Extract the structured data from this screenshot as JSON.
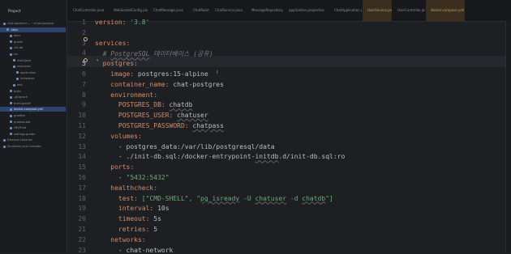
{
  "sidebar": {
    "title": "Project",
    "items": [
      {
        "label": "chat-backend — ~/chat-backend",
        "selected": false
      },
      {
        "label": ".idea",
        "selected": true
      },
      {
        "label": "docs",
        "selected": false
      },
      {
        "label": "gradle",
        "selected": false
      },
      {
        "label": "init-db",
        "selected": false
      },
      {
        "label": "src",
        "selected": false
      },
      {
        "label": "main/java",
        "selected": false
      },
      {
        "label": "resources",
        "selected": false
      },
      {
        "label": "application",
        "selected": false
      },
      {
        "label": "templates",
        "selected": false
      },
      {
        "label": "test",
        "selected": false
      },
      {
        "label": "build",
        "selected": false
      },
      {
        "label": ".gitignore",
        "selected": false
      },
      {
        "label": "build.gradle",
        "selected": false
      },
      {
        "label": "docker-compose.yml",
        "selected": true
      },
      {
        "label": "gradlew",
        "selected": false
      },
      {
        "label": "gradlew.bat",
        "selected": false
      },
      {
        "label": "HELP.md",
        "selected": false
      },
      {
        "label": "settings.gradle",
        "selected": false
      },
      {
        "label": "External Libraries",
        "selected": false
      },
      {
        "label": "Scratches and Consoles",
        "selected": false
      }
    ]
  },
  "tabs": [
    {
      "label": "ChatController.java",
      "active": false
    },
    {
      "label": "WebSocketConfig.java",
      "active": false
    },
    {
      "label": "ChatMessage.java",
      "active": false
    },
    {
      "label": "ChatRoom.java",
      "active": false
    },
    {
      "label": "ChatService.java",
      "active": false
    },
    {
      "label": "MessageRepository.java",
      "active": false
    },
    {
      "label": "application.properties",
      "active": false
    },
    {
      "label": "ChatApplication.java",
      "active": false
    },
    {
      "label": "UserService.java",
      "active": false
    },
    {
      "label": "UserController.java",
      "active": false
    },
    {
      "label": "docker-compose.yml",
      "active": true
    }
  ],
  "editor": {
    "current_line": 5,
    "lines": [
      {
        "n": "1",
        "tokens": [
          {
            "t": "version: ",
            "c": "k"
          },
          {
            "t": "'3.8'",
            "c": "s"
          }
        ]
      },
      {
        "n": "2",
        "tokens": []
      },
      {
        "n": "3",
        "tokens": [
          {
            "t": "services:",
            "c": "k"
          }
        ]
      },
      {
        "n": "4",
        "tokens": [
          {
            "t": "  # ",
            "c": "c"
          },
          {
            "t": "PostgreSQL",
            "c": "c u"
          },
          {
            "t": " 데이터베이스 (공유)",
            "c": "c"
          }
        ]
      },
      {
        "n": "5",
        "tokens": [
          {
            "t": "  postgres:",
            "c": "k"
          }
        ]
      },
      {
        "n": "6",
        "tokens": [
          {
            "t": "    image: ",
            "c": "k"
          },
          {
            "t": "postgres:15-alpine",
            "c": "p"
          }
        ]
      },
      {
        "n": "7",
        "tokens": [
          {
            "t": "    container_name: ",
            "c": "k"
          },
          {
            "t": "chat-postgres",
            "c": "p"
          }
        ]
      },
      {
        "n": "8",
        "tokens": [
          {
            "t": "    environment:",
            "c": "k"
          }
        ]
      },
      {
        "n": "9",
        "tokens": [
          {
            "t": "      POSTGRES_DB: ",
            "c": "k"
          },
          {
            "t": "chatdb",
            "c": "p u"
          }
        ]
      },
      {
        "n": "10",
        "tokens": [
          {
            "t": "      POSTGRES_USER: ",
            "c": "k"
          },
          {
            "t": "chatuser",
            "c": "p u"
          }
        ]
      },
      {
        "n": "11",
        "tokens": [
          {
            "t": "      POSTGRES_PASSWORD: ",
            "c": "k"
          },
          {
            "t": "chatpass",
            "c": "p u"
          }
        ]
      },
      {
        "n": "12",
        "tokens": [
          {
            "t": "    volumes:",
            "c": "k"
          }
        ]
      },
      {
        "n": "13",
        "tokens": [
          {
            "t": "      - postgres_data:/var/lib/postgresql/data",
            "c": "p"
          }
        ]
      },
      {
        "n": "14",
        "tokens": [
          {
            "t": "      - ./init-db.sql:/docker-entrypoint-",
            "c": "p"
          },
          {
            "t": "initdb",
            "c": "p u"
          },
          {
            "t": ".d/init-db.sql:ro",
            "c": "p"
          }
        ]
      },
      {
        "n": "15",
        "tokens": [
          {
            "t": "    ports:",
            "c": "k"
          }
        ]
      },
      {
        "n": "16",
        "tokens": [
          {
            "t": "      - ",
            "c": "p"
          },
          {
            "t": "\"5432:5432\"",
            "c": "s"
          }
        ]
      },
      {
        "n": "17",
        "tokens": [
          {
            "t": "    healthcheck:",
            "c": "k"
          }
        ]
      },
      {
        "n": "18",
        "tokens": [
          {
            "t": "      test: ",
            "c": "k"
          },
          {
            "t": "[\"CMD-SHELL\", \"",
            "c": "s"
          },
          {
            "t": "pg_isready",
            "c": "s u"
          },
          {
            "t": " -U ",
            "c": "s"
          },
          {
            "t": "chatuser",
            "c": "s u"
          },
          {
            "t": " -d ",
            "c": "s"
          },
          {
            "t": "chatdb",
            "c": "s u"
          },
          {
            "t": "\"]",
            "c": "s"
          }
        ]
      },
      {
        "n": "19",
        "tokens": [
          {
            "t": "      interval: ",
            "c": "k"
          },
          {
            "t": "10s",
            "c": "p"
          }
        ]
      },
      {
        "n": "20",
        "tokens": [
          {
            "t": "      timeout: ",
            "c": "k"
          },
          {
            "t": "5s",
            "c": "p"
          }
        ]
      },
      {
        "n": "21",
        "tokens": [
          {
            "t": "      retries: ",
            "c": "k"
          },
          {
            "t": "5",
            "c": "p"
          }
        ]
      },
      {
        "n": "22",
        "tokens": [
          {
            "t": "    networks:",
            "c": "k"
          }
        ]
      },
      {
        "n": "23",
        "tokens": [
          {
            "t": "      - chat-network",
            "c": "p"
          }
        ]
      }
    ]
  },
  "colors": {
    "key": "#cf8e6d",
    "string": "#6aab73",
    "comment": "#7a7e85",
    "plain": "#bcbec4",
    "background": "#1e1f22",
    "selection": "#2e436e"
  }
}
